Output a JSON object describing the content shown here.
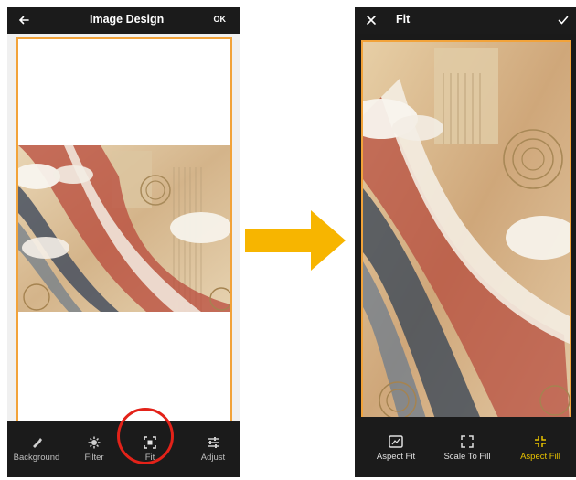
{
  "left_screen": {
    "title": "Image Design",
    "ok_label": "OK",
    "tools": [
      {
        "label": "Background",
        "icon": "brush-icon"
      },
      {
        "label": "Filter",
        "icon": "filter-icon"
      },
      {
        "label": "Fit",
        "icon": "fit-icon",
        "highlighted": true
      },
      {
        "label": "Adjust",
        "icon": "sliders-icon"
      }
    ]
  },
  "right_screen": {
    "title": "Fit",
    "options": [
      {
        "label": "Aspect Fit",
        "icon": "aspect-fit-icon"
      },
      {
        "label": "Scale To Fill",
        "icon": "scale-to-fill-icon"
      },
      {
        "label": "Aspect Fill",
        "icon": "aspect-fill-icon",
        "selected": true
      }
    ]
  },
  "colors": {
    "frame_orange": "#f2a33a",
    "arrow_yellow": "#f7b500",
    "highlight_red": "#e32219",
    "active_yellow": "#e8c200",
    "bar_dark": "#1b1b1b"
  }
}
